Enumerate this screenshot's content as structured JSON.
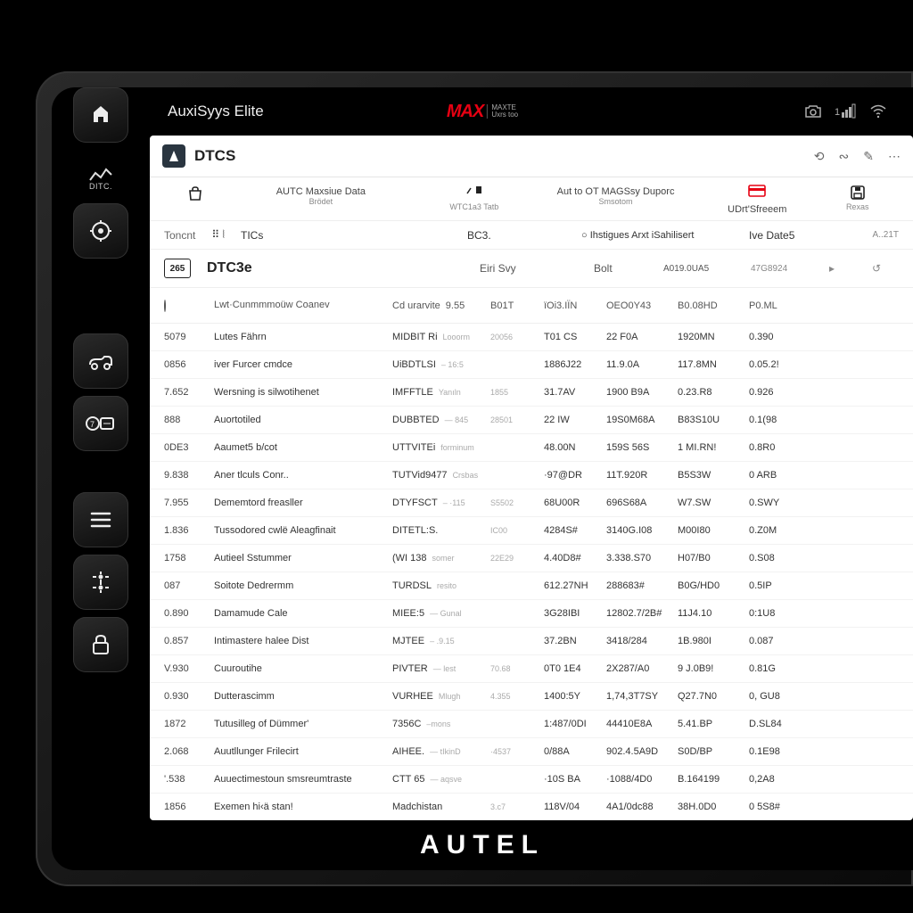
{
  "top": {
    "title": "AuxiSyys Elite",
    "brand_red": "MAX",
    "brand_side1": "MAXTE",
    "brand_side2": "Uxrs too"
  },
  "page": {
    "title": "DTCS"
  },
  "h2": {
    "col0_lab1": "",
    "col1_lab1": "AUTC Maxsiue Data",
    "col1_lab2": "Brödet",
    "col2_lab1": "",
    "col2_lab2": "WTC1a3 Tatb",
    "col3_lab1": "Aut to OT MAGSsy Duporc",
    "col3_lab2": "Smsotom",
    "col4_lab1": "UDrt'Sfreeem",
    "col5_lab1": "Rexas"
  },
  "h3": {
    "k0": "Toncnt",
    "v0": "⠿ ⦚",
    "v1": "TICs",
    "v2": "BC3.",
    "v3": "○ Ihstigues Arxt iSahilisert",
    "v4": "Ive Date5",
    "v5": "A..21T"
  },
  "h4": {
    "box": "265",
    "big": "DTC3e",
    "c2": "Eiri Svy",
    "c4": "Bolt",
    "c5": "A019.0UA5",
    "c6": "47G8924",
    "arr1": "▸",
    "arr2": "↺"
  },
  "thead": {
    "c1": "Lwt·Cunmmmoüw Coanev",
    "c2": "Cd urarvite",
    "c2b": "9.55",
    "c3": "B01T",
    "c4": "ïOi3.IÏN",
    "c5": "OEO0Y43",
    "c6": "B0.08HD",
    "c7": "P0.ML",
    "c8": ""
  },
  "rows": [
    {
      "c0": "5079",
      "c1": "Lutes Fährn",
      "c2a": "MIDBIT Ri",
      "c2b": "Looorm",
      "c3": "20056",
      "c4": "T01 CS",
      "c5": "22 F0A",
      "c6": "1920MN",
      "c7": "0.390"
    },
    {
      "c0": "0856",
      "c1": "iver Furcer cmdce",
      "c2a": "UiBDTLSI",
      "c2b": "– 16:5",
      "c3": "",
      "c4": "1886J22",
      "c5": "11.9.0A",
      "c6": "117.8MN",
      "c7": "0.05.2!"
    },
    {
      "c0": "7.652",
      "c1": "Wersning is silwotihenet",
      "c2a": "IMFFTLE",
      "c2b": "Yanıln",
      "c3": "1855",
      "c4": "31.7AV",
      "c5": "1900 B9A",
      "c6": "0.23.R8",
      "c7": "0.926"
    },
    {
      "c0": "888",
      "c1": "Auortotiled",
      "c2a": "DUBBTED",
      "c2b": "— 845",
      "c3": "28501",
      "c4": "22 IW",
      "c5": "19S0M68A",
      "c6": "B83S10U",
      "c7": "0.1(98"
    },
    {
      "c0": "0DE3",
      "c1": "Aaumet5 b/cot",
      "c2a": "UTTVITEi",
      "c2b": "forminum",
      "c3": "",
      "c4": "48.00N",
      "c5": "159S 56S",
      "c6": "1 MI.RN!",
      "c7": "0.8R0"
    },
    {
      "c0": "9.838",
      "c1": "Aner tlculs Conr..",
      "c2a": "TUTVid9477",
      "c2b": "Crsbas",
      "c3": "",
      "c4": "·97@DR",
      "c5": "11T.920R",
      "c6": "B5S3W",
      "c7": "0 ARB"
    },
    {
      "c0": "7.955",
      "c1": "Dememtord freasller",
      "c2a": "DTYFSCT",
      "c2b": "– ·115",
      "c3": "S5502",
      "c4": "68U00R",
      "c5": "696S68A",
      "c6": "W7.SW",
      "c7": "0.SWY"
    },
    {
      "c0": "1.836",
      "c1": "Tussodored cwlë Aleagfinait",
      "c2a": "DITETL:S.",
      "c2b": "",
      "c3": "IC00",
      "c4": "4284S#",
      "c5": "3140G.I08",
      "c6": "M00I80",
      "c7": "0.Z0M"
    },
    {
      "c0": "1758",
      "c1": "Autieel Sstummer",
      "c2a": "(WI 138",
      "c2b": "somer",
      "c3": "22E29",
      "c4": "4.40D8#",
      "c5": "3.338.S70",
      "c6": "H07/B0",
      "c7": "0.S08"
    },
    {
      "c0": "087",
      "c1": "Soitote Dedrermm",
      "c2a": "TURDSL",
      "c2b": "resito",
      "c3": "",
      "c4": "612.27NH",
      "c5": "288683#",
      "c6": "B0G/HD0",
      "c7": "0.5IP"
    },
    {
      "c0": "0.890",
      "c1": "Damamude Cale",
      "c2a": "MIEE:5",
      "c2b": "— Gunal",
      "c3": "",
      "c4": "3G28IBI",
      "c5": "12802.7/2B#",
      "c6": "11J4.10",
      "c7": "0:1U8"
    },
    {
      "c0": "0.857",
      "c1": "Intimastere halee Dist",
      "c2a": "MJTEE",
      "c2b": "– .9.15",
      "c3": "",
      "c4": "37.2BN",
      "c5": "3418/284",
      "c6": "1B.980I",
      "c7": "0.087"
    },
    {
      "c0": "V.930",
      "c1": "Cuuroutihe",
      "c2a": "PIVTER",
      "c2b": "— lest",
      "c3": "70.68",
      "c4": "0T0 1E4",
      "c5": "2X287/A0",
      "c6": "9 J.0B9!",
      "c7": "0.81G"
    },
    {
      "c0": "0.930",
      "c1": "Dutterascimm",
      "c2a": "VURHEE",
      "c2b": "Mlugh",
      "c3": "4.355",
      "c4": "1400:5Y",
      "c5": "1,74,3T7SY",
      "c6": "Q27.7N0",
      "c7": "0, GU8"
    },
    {
      "c0": "1872",
      "c1": "Tutusilleg of Dümmer'",
      "c2a": "7356C",
      "c2b": "–mons",
      "c3": "",
      "c4": "1:487/0DI",
      "c5": "44410E8A",
      "c6": "5.41.BP",
      "c7": "D.SL84"
    },
    {
      "c0": "2.068",
      "c1": "Auutllunger Frilecirt",
      "c2a": "AIHEE.",
      "c2b": "— tIkinD",
      "c3": "·4537",
      "c4": "0/88A",
      "c5": "902.4.5A9D",
      "c6": "S0D/BP",
      "c7": "0.1E98"
    },
    {
      "c0": "'.538",
      "c1": "Auuectimestoun smsreumtraste",
      "c2a": "CTT 65",
      "c2b": "— aqsve",
      "c3": "",
      "c4": "·10S BA",
      "c5": "·1088/4D0",
      "c6": "B.164199",
      "c7": "0,2A8"
    },
    {
      "c0": "1856",
      "c1": "Exemen hi‹ä stan!",
      "c2a": "Madchistan",
      "c2b": "",
      "c3": "3.c7",
      "c4": "118V/04",
      "c5": "4A1/0dc88",
      "c6": "38H.0D0",
      "c7": "0 5S8#"
    }
  ],
  "footer_brand": "AUTEL",
  "side_dtc_label": "DITC."
}
